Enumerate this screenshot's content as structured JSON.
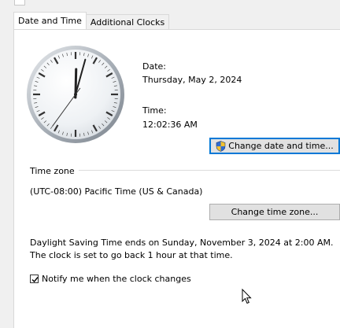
{
  "tabs": [
    {
      "label": "Date and Time",
      "active": true
    },
    {
      "label": "Additional Clocks",
      "active": false
    }
  ],
  "date": {
    "label": "Date:",
    "value": "Thursday, May 2, 2024"
  },
  "time": {
    "label": "Time:",
    "value": "12:02:36 AM"
  },
  "clock": {
    "hours": 0,
    "minutes": 2,
    "seconds": 36
  },
  "buttons": {
    "change_datetime": "Change date and time...",
    "change_timezone": "Change time zone..."
  },
  "timezone": {
    "heading": "Time zone",
    "value": "(UTC-08:00) Pacific Time (US & Canada)"
  },
  "dst_notice": "Daylight Saving Time ends on Sunday, November 3, 2024 at 2:00 AM. The clock is set to go back 1 hour at that time.",
  "notify": {
    "label": "Notify me when the clock changes",
    "checked": true
  },
  "colors": {
    "default_button_border": "#0078d7",
    "tab_border": "#d9d9d9"
  }
}
